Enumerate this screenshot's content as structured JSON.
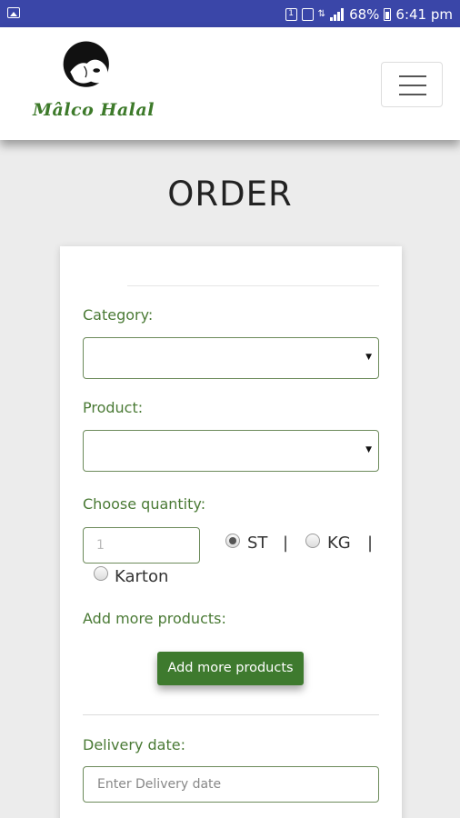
{
  "status_bar": {
    "sim_badge": "1",
    "battery_percent": "68%",
    "time": "6:41 pm"
  },
  "header": {
    "brand": "Mâlco Halal"
  },
  "page": {
    "title": "ORDER"
  },
  "form": {
    "category_label": "Category:",
    "product_label": "Product:",
    "quantity_label": "Choose quantity:",
    "quantity_placeholder": "1",
    "units": [
      {
        "label": "ST",
        "checked": true
      },
      {
        "label": "KG",
        "checked": false
      },
      {
        "label": "Karton",
        "checked": false
      }
    ],
    "separator": "|",
    "add_more_label": "Add more products:",
    "add_more_button": "Add more products",
    "delivery_label": "Delivery date:",
    "delivery_placeholder": "Enter Delivery date"
  },
  "colors": {
    "status_bar": "#3a46a8",
    "accent_green": "#3e7a2e",
    "label_green": "#4a7a35"
  }
}
